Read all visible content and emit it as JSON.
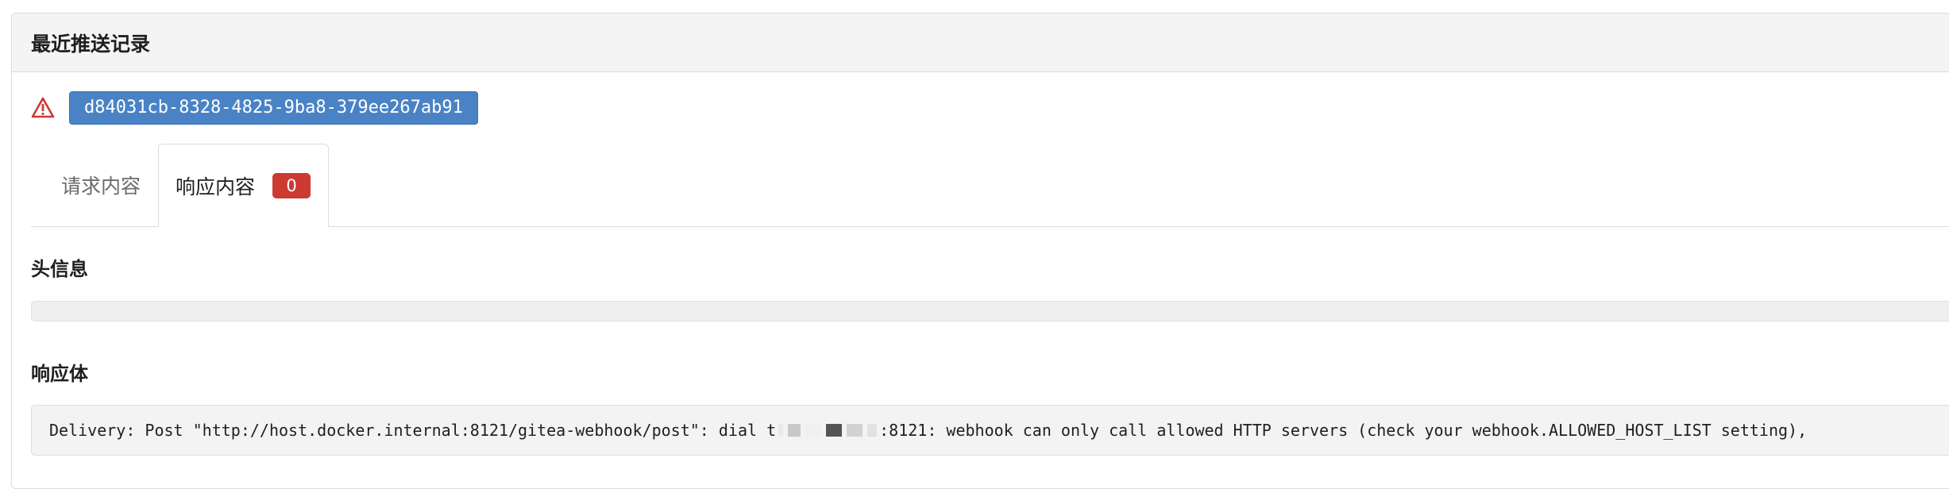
{
  "section": {
    "title": "最近推送记录"
  },
  "delivery": {
    "status_icon": "warning-triangle-icon",
    "uuid": "d84031cb-8328-4825-9ba8-379ee267ab91",
    "status_color": "#cc3a32",
    "uuid_color": "#4a83c5"
  },
  "tabs": {
    "request_label": "请求内容",
    "response_label": "响应内容",
    "response_badge": "0",
    "active": "response"
  },
  "response": {
    "headers_title": "头信息",
    "headers_content": "",
    "body_title": "响应体",
    "body_prefix": "Delivery: Post \"http://host.docker.internal:8121/gitea-webhook/post\": dial t",
    "body_suffix": ":8121: webhook can only call allowed HTTP servers (check your webhook.ALLOWED_HOST_LIST setting),"
  }
}
